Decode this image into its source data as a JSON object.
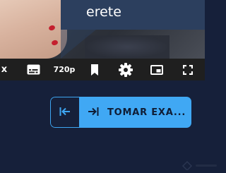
{
  "video": {
    "title_fragment": "erete"
  },
  "controls": {
    "speed_suffix": "x",
    "quality": "720p",
    "icons": [
      "captions-icon",
      "bookmark-icon",
      "gear-icon",
      "picture-in-picture-icon",
      "fullscreen-icon"
    ]
  },
  "nav": {
    "back_icon": "collapse-left-icon",
    "next_icon": "expand-right-icon",
    "next_label": "TOMAR EXA..."
  },
  "colors": {
    "page_background": "#16203a",
    "accent": "#40a8f4",
    "control_bar": "#1f1f1f",
    "title_overlay": "#2c3f5e"
  }
}
